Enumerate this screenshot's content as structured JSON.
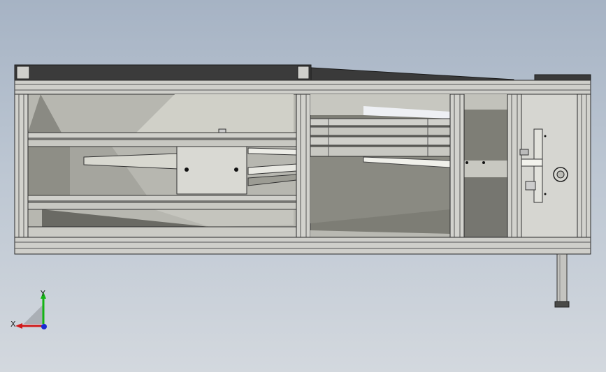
{
  "viewport": {
    "background_top": "#a6b3c4",
    "background_bottom": "#d3d8de"
  },
  "triad": {
    "x_label": "X",
    "y_label": "Y",
    "x_color": "#d11a1a",
    "y_color": "#14b414",
    "z_color": "#1a2ad1"
  },
  "model": {
    "frame_color": "#c8c8c4",
    "frame_edge": "#2a2a2a",
    "panel_dark": "#3a3a3a",
    "interior_light": "#b9b9b3",
    "interior_mid": "#8f8f88",
    "interior_dark": "#5c5c56"
  }
}
